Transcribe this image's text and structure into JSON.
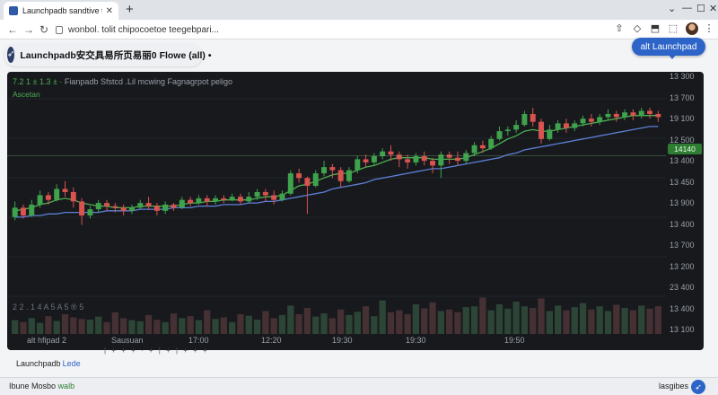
{
  "browser": {
    "tab_title": "Launchpadb sandtive testect",
    "tab_close": "✕",
    "new_tab": "+",
    "url": "wonbol. tolit chipocoetoe teegebpari..."
  },
  "header": {
    "title": "Launchpadb安交具易所页易丽0 Flowe (all) •",
    "launch_button": "alt  Launchpad"
  },
  "chart": {
    "ohlc_values": "7.2 1 ± 1.3 ±  ·",
    "ohlc_title": "Fianpadb Sfstcd .Lil  mcwing Fagnagrpot peligo",
    "sub_label": "Ascetan",
    "volume_label": "2 2 . 1 4  A 5 A 5  ®  5",
    "bottom_left": "alt hfipad 2",
    "price_tag": "14140",
    "x_ticks": [
      "Sausuan",
      "17:00",
      "12:20",
      "19:30",
      "19:30",
      "19:50"
    ]
  },
  "chart_data": {
    "type": "candlestick",
    "y_ticks": [
      "13 300",
      "13 700",
      "19 100",
      "12 500",
      "13 400",
      "13 450",
      "13 900",
      "13 400",
      "13 700",
      "13 200",
      "23 400",
      "13 400",
      "13 100"
    ],
    "candles": [
      [
        0.3,
        0.36,
        0.28,
        0.4
      ],
      [
        0.36,
        0.31,
        0.29,
        0.38
      ],
      [
        0.31,
        0.38,
        0.3,
        0.41
      ],
      [
        0.38,
        0.44,
        0.36,
        0.47
      ],
      [
        0.44,
        0.41,
        0.38,
        0.46
      ],
      [
        0.41,
        0.48,
        0.4,
        0.51
      ],
      [
        0.48,
        0.46,
        0.43,
        0.53
      ],
      [
        0.46,
        0.4,
        0.36,
        0.49
      ],
      [
        0.4,
        0.31,
        0.25,
        0.42
      ],
      [
        0.31,
        0.35,
        0.29,
        0.37
      ],
      [
        0.35,
        0.39,
        0.33,
        0.41
      ],
      [
        0.39,
        0.37,
        0.34,
        0.41
      ],
      [
        0.37,
        0.36,
        0.33,
        0.39
      ],
      [
        0.36,
        0.34,
        0.31,
        0.38
      ],
      [
        0.34,
        0.36,
        0.32,
        0.38
      ],
      [
        0.36,
        0.39,
        0.35,
        0.41
      ],
      [
        0.39,
        0.37,
        0.35,
        0.43
      ],
      [
        0.37,
        0.34,
        0.31,
        0.39
      ],
      [
        0.34,
        0.38,
        0.32,
        0.4
      ],
      [
        0.38,
        0.36,
        0.34,
        0.39
      ],
      [
        0.36,
        0.41,
        0.35,
        0.43
      ],
      [
        0.41,
        0.39,
        0.37,
        0.43
      ],
      [
        0.39,
        0.42,
        0.38,
        0.44
      ],
      [
        0.42,
        0.4,
        0.37,
        0.44
      ],
      [
        0.4,
        0.42,
        0.38,
        0.44
      ],
      [
        0.42,
        0.41,
        0.39,
        0.44
      ],
      [
        0.41,
        0.43,
        0.4,
        0.45
      ],
      [
        0.43,
        0.4,
        0.38,
        0.45
      ],
      [
        0.4,
        0.43,
        0.39,
        0.46
      ],
      [
        0.43,
        0.46,
        0.41,
        0.48
      ],
      [
        0.46,
        0.44,
        0.4,
        0.48
      ],
      [
        0.44,
        0.41,
        0.38,
        0.47
      ],
      [
        0.41,
        0.45,
        0.4,
        0.47
      ],
      [
        0.45,
        0.58,
        0.44,
        0.6
      ],
      [
        0.58,
        0.55,
        0.52,
        0.61
      ],
      [
        0.55,
        0.5,
        0.32,
        0.56
      ],
      [
        0.5,
        0.58,
        0.49,
        0.6
      ],
      [
        0.58,
        0.62,
        0.56,
        0.66
      ],
      [
        0.62,
        0.6,
        0.55,
        0.64
      ],
      [
        0.6,
        0.53,
        0.49,
        0.62
      ],
      [
        0.53,
        0.6,
        0.52,
        0.62
      ],
      [
        0.6,
        0.67,
        0.58,
        0.69
      ],
      [
        0.67,
        0.65,
        0.62,
        0.7
      ],
      [
        0.65,
        0.69,
        0.63,
        0.71
      ],
      [
        0.69,
        0.72,
        0.67,
        0.74
      ],
      [
        0.72,
        0.7,
        0.66,
        0.76
      ],
      [
        0.7,
        0.67,
        0.62,
        0.72
      ],
      [
        0.67,
        0.65,
        0.61,
        0.7
      ],
      [
        0.65,
        0.69,
        0.63,
        0.71
      ],
      [
        0.69,
        0.66,
        0.63,
        0.72
      ],
      [
        0.66,
        0.63,
        0.58,
        0.68
      ],
      [
        0.63,
        0.7,
        0.55,
        0.72
      ],
      [
        0.7,
        0.68,
        0.64,
        0.72
      ],
      [
        0.68,
        0.66,
        0.63,
        0.72
      ],
      [
        0.66,
        0.71,
        0.64,
        0.73
      ],
      [
        0.71,
        0.76,
        0.69,
        0.78
      ],
      [
        0.76,
        0.74,
        0.71,
        0.79
      ],
      [
        0.74,
        0.8,
        0.73,
        0.82
      ],
      [
        0.8,
        0.85,
        0.79,
        0.88
      ],
      [
        0.85,
        0.86,
        0.82,
        0.88
      ],
      [
        0.86,
        0.89,
        0.84,
        0.92
      ],
      [
        0.89,
        0.96,
        0.88,
        0.98
      ],
      [
        0.96,
        0.91,
        0.88,
        1.0
      ],
      [
        0.91,
        0.8,
        0.77,
        0.93
      ],
      [
        0.8,
        0.86,
        0.79,
        0.89
      ],
      [
        0.86,
        0.9,
        0.84,
        0.92
      ],
      [
        0.9,
        0.87,
        0.84,
        0.93
      ],
      [
        0.87,
        0.9,
        0.85,
        0.92
      ],
      [
        0.9,
        0.93,
        0.88,
        0.95
      ],
      [
        0.93,
        0.91,
        0.88,
        0.96
      ],
      [
        0.91,
        0.94,
        0.89,
        0.96
      ],
      [
        0.94,
        0.96,
        0.92,
        0.99
      ],
      [
        0.96,
        0.94,
        0.91,
        0.98
      ],
      [
        0.94,
        0.97,
        0.92,
        0.99
      ],
      [
        0.97,
        0.95,
        0.92,
        0.99
      ],
      [
        0.95,
        0.98,
        0.93,
        1.0
      ],
      [
        0.98,
        0.96,
        0.93,
        1.0
      ],
      [
        0.96,
        0.94,
        0.91,
        0.98
      ]
    ],
    "ma_fast": [
      0.34,
      0.35,
      0.36,
      0.38,
      0.39,
      0.41,
      0.42,
      0.41,
      0.39,
      0.38,
      0.37,
      0.37,
      0.36,
      0.36,
      0.36,
      0.37,
      0.37,
      0.37,
      0.37,
      0.37,
      0.38,
      0.39,
      0.39,
      0.4,
      0.4,
      0.41,
      0.41,
      0.41,
      0.41,
      0.42,
      0.43,
      0.43,
      0.44,
      0.47,
      0.5,
      0.51,
      0.53,
      0.55,
      0.57,
      0.58,
      0.58,
      0.6,
      0.62,
      0.63,
      0.65,
      0.67,
      0.68,
      0.68,
      0.68,
      0.68,
      0.67,
      0.67,
      0.67,
      0.67,
      0.68,
      0.7,
      0.72,
      0.74,
      0.77,
      0.8,
      0.82,
      0.85,
      0.86,
      0.85,
      0.85,
      0.86,
      0.87,
      0.88,
      0.89,
      0.9,
      0.91,
      0.92,
      0.93,
      0.94,
      0.95,
      0.95,
      0.95,
      0.95
    ],
    "ma_slow": [
      0.3,
      0.3,
      0.31,
      0.31,
      0.32,
      0.32,
      0.33,
      0.33,
      0.33,
      0.33,
      0.33,
      0.34,
      0.34,
      0.34,
      0.34,
      0.35,
      0.35,
      0.35,
      0.35,
      0.36,
      0.36,
      0.36,
      0.37,
      0.37,
      0.37,
      0.38,
      0.38,
      0.38,
      0.39,
      0.39,
      0.4,
      0.4,
      0.41,
      0.42,
      0.43,
      0.44,
      0.45,
      0.46,
      0.48,
      0.49,
      0.5,
      0.51,
      0.52,
      0.54,
      0.55,
      0.56,
      0.57,
      0.58,
      0.59,
      0.6,
      0.61,
      0.61,
      0.62,
      0.63,
      0.64,
      0.65,
      0.66,
      0.67,
      0.68,
      0.7,
      0.71,
      0.73,
      0.74,
      0.75,
      0.76,
      0.77,
      0.78,
      0.79,
      0.8,
      0.81,
      0.82,
      0.83,
      0.84,
      0.85,
      0.86,
      0.87,
      0.88,
      0.88
    ],
    "volume": [
      0.35,
      0.3,
      0.4,
      0.28,
      0.45,
      0.33,
      0.5,
      0.42,
      0.38,
      0.36,
      0.44,
      0.3,
      0.55,
      0.4,
      0.35,
      0.32,
      0.48,
      0.36,
      0.3,
      0.52,
      0.4,
      0.45,
      0.35,
      0.6,
      0.38,
      0.42,
      0.3,
      0.5,
      0.46,
      0.36,
      0.58,
      0.4,
      0.48,
      0.72,
      0.5,
      0.66,
      0.44,
      0.52,
      0.4,
      0.62,
      0.48,
      0.56,
      0.7,
      0.45,
      0.85,
      0.55,
      0.6,
      0.5,
      0.75,
      0.65,
      0.8,
      0.58,
      0.62,
      0.55,
      0.68,
      0.7,
      0.92,
      0.6,
      0.75,
      0.64,
      0.82,
      0.7,
      0.66,
      0.9,
      0.58,
      0.72,
      0.6,
      0.68,
      0.78,
      0.62,
      0.7,
      0.58,
      0.74,
      0.66,
      0.6,
      0.72,
      0.64,
      0.7
    ]
  },
  "footer": {
    "tools": "|  +  +  +  ·  +  |  +  |   +  +  +",
    "link_prefix": "Launchpadb",
    "link_blue": "Lede",
    "status_left": "Ibune Mosbo",
    "status_left_green": "walb",
    "status_right": "lasgibes"
  },
  "colors": {
    "up": "#3fa34d",
    "down": "#d9534f",
    "ma_fast": "#4caf50",
    "ma_slow": "#5c7fd6",
    "panel_bg": "#17191d",
    "accent": "#2d64c8"
  }
}
